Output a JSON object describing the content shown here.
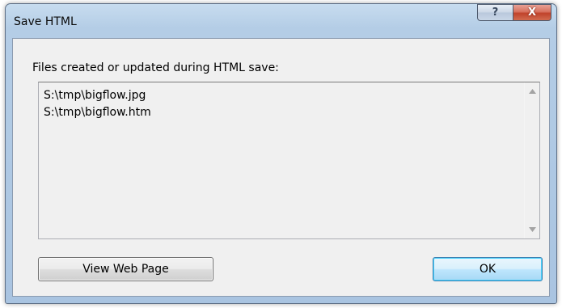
{
  "window": {
    "title": "Save HTML",
    "help_symbol": "?",
    "close_symbol": "X"
  },
  "dialog": {
    "label": "Files created or updated during HTML save:",
    "files": [
      "S:\\tmp\\bigflow.jpg",
      "S:\\tmp\\bigflow.htm"
    ],
    "view_button_label": "View Web Page",
    "ok_button_label": "OK"
  },
  "icons": {
    "scroll_up": "scroll-up-arrow-icon",
    "scroll_down": "scroll-down-arrow-icon"
  }
}
